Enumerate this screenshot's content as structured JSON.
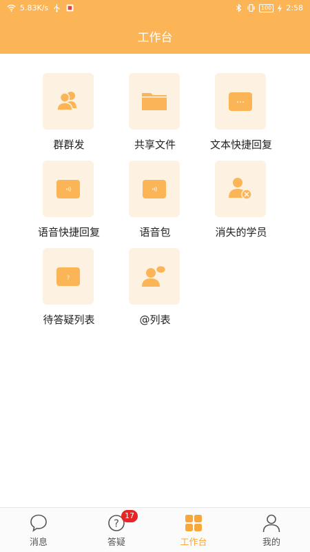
{
  "status_bar": {
    "network_speed": "5.83K/s",
    "battery": "100",
    "time": "2:58"
  },
  "header": {
    "title": "工作台"
  },
  "tools": [
    {
      "label": "群群发",
      "icon": "group-users-icon"
    },
    {
      "label": "共享文件",
      "icon": "folder-icon"
    },
    {
      "label": "文本快捷回复",
      "icon": "text-reply-icon"
    },
    {
      "label": "语音快捷回复",
      "icon": "voice-reply-icon"
    },
    {
      "label": "语音包",
      "icon": "voice-pack-icon"
    },
    {
      "label": "消失的学员",
      "icon": "removed-user-icon"
    },
    {
      "label": "待答疑列表",
      "icon": "question-list-icon"
    },
    {
      "label": "@列表",
      "icon": "mention-list-icon"
    }
  ],
  "tabbar": {
    "items": [
      {
        "label": "消息",
        "icon": "chat-bubble-icon",
        "active": false
      },
      {
        "label": "答疑",
        "icon": "question-icon",
        "active": false,
        "badge": "17"
      },
      {
        "label": "工作台",
        "icon": "grid-icon",
        "active": true
      },
      {
        "label": "我的",
        "icon": "person-icon",
        "active": false
      }
    ]
  },
  "colors": {
    "brand": "#fbb557",
    "icon": "#fbb557",
    "tile_bg": "#fdf2e1",
    "badge": "#e62525",
    "active_tab": "#f8a83a"
  }
}
